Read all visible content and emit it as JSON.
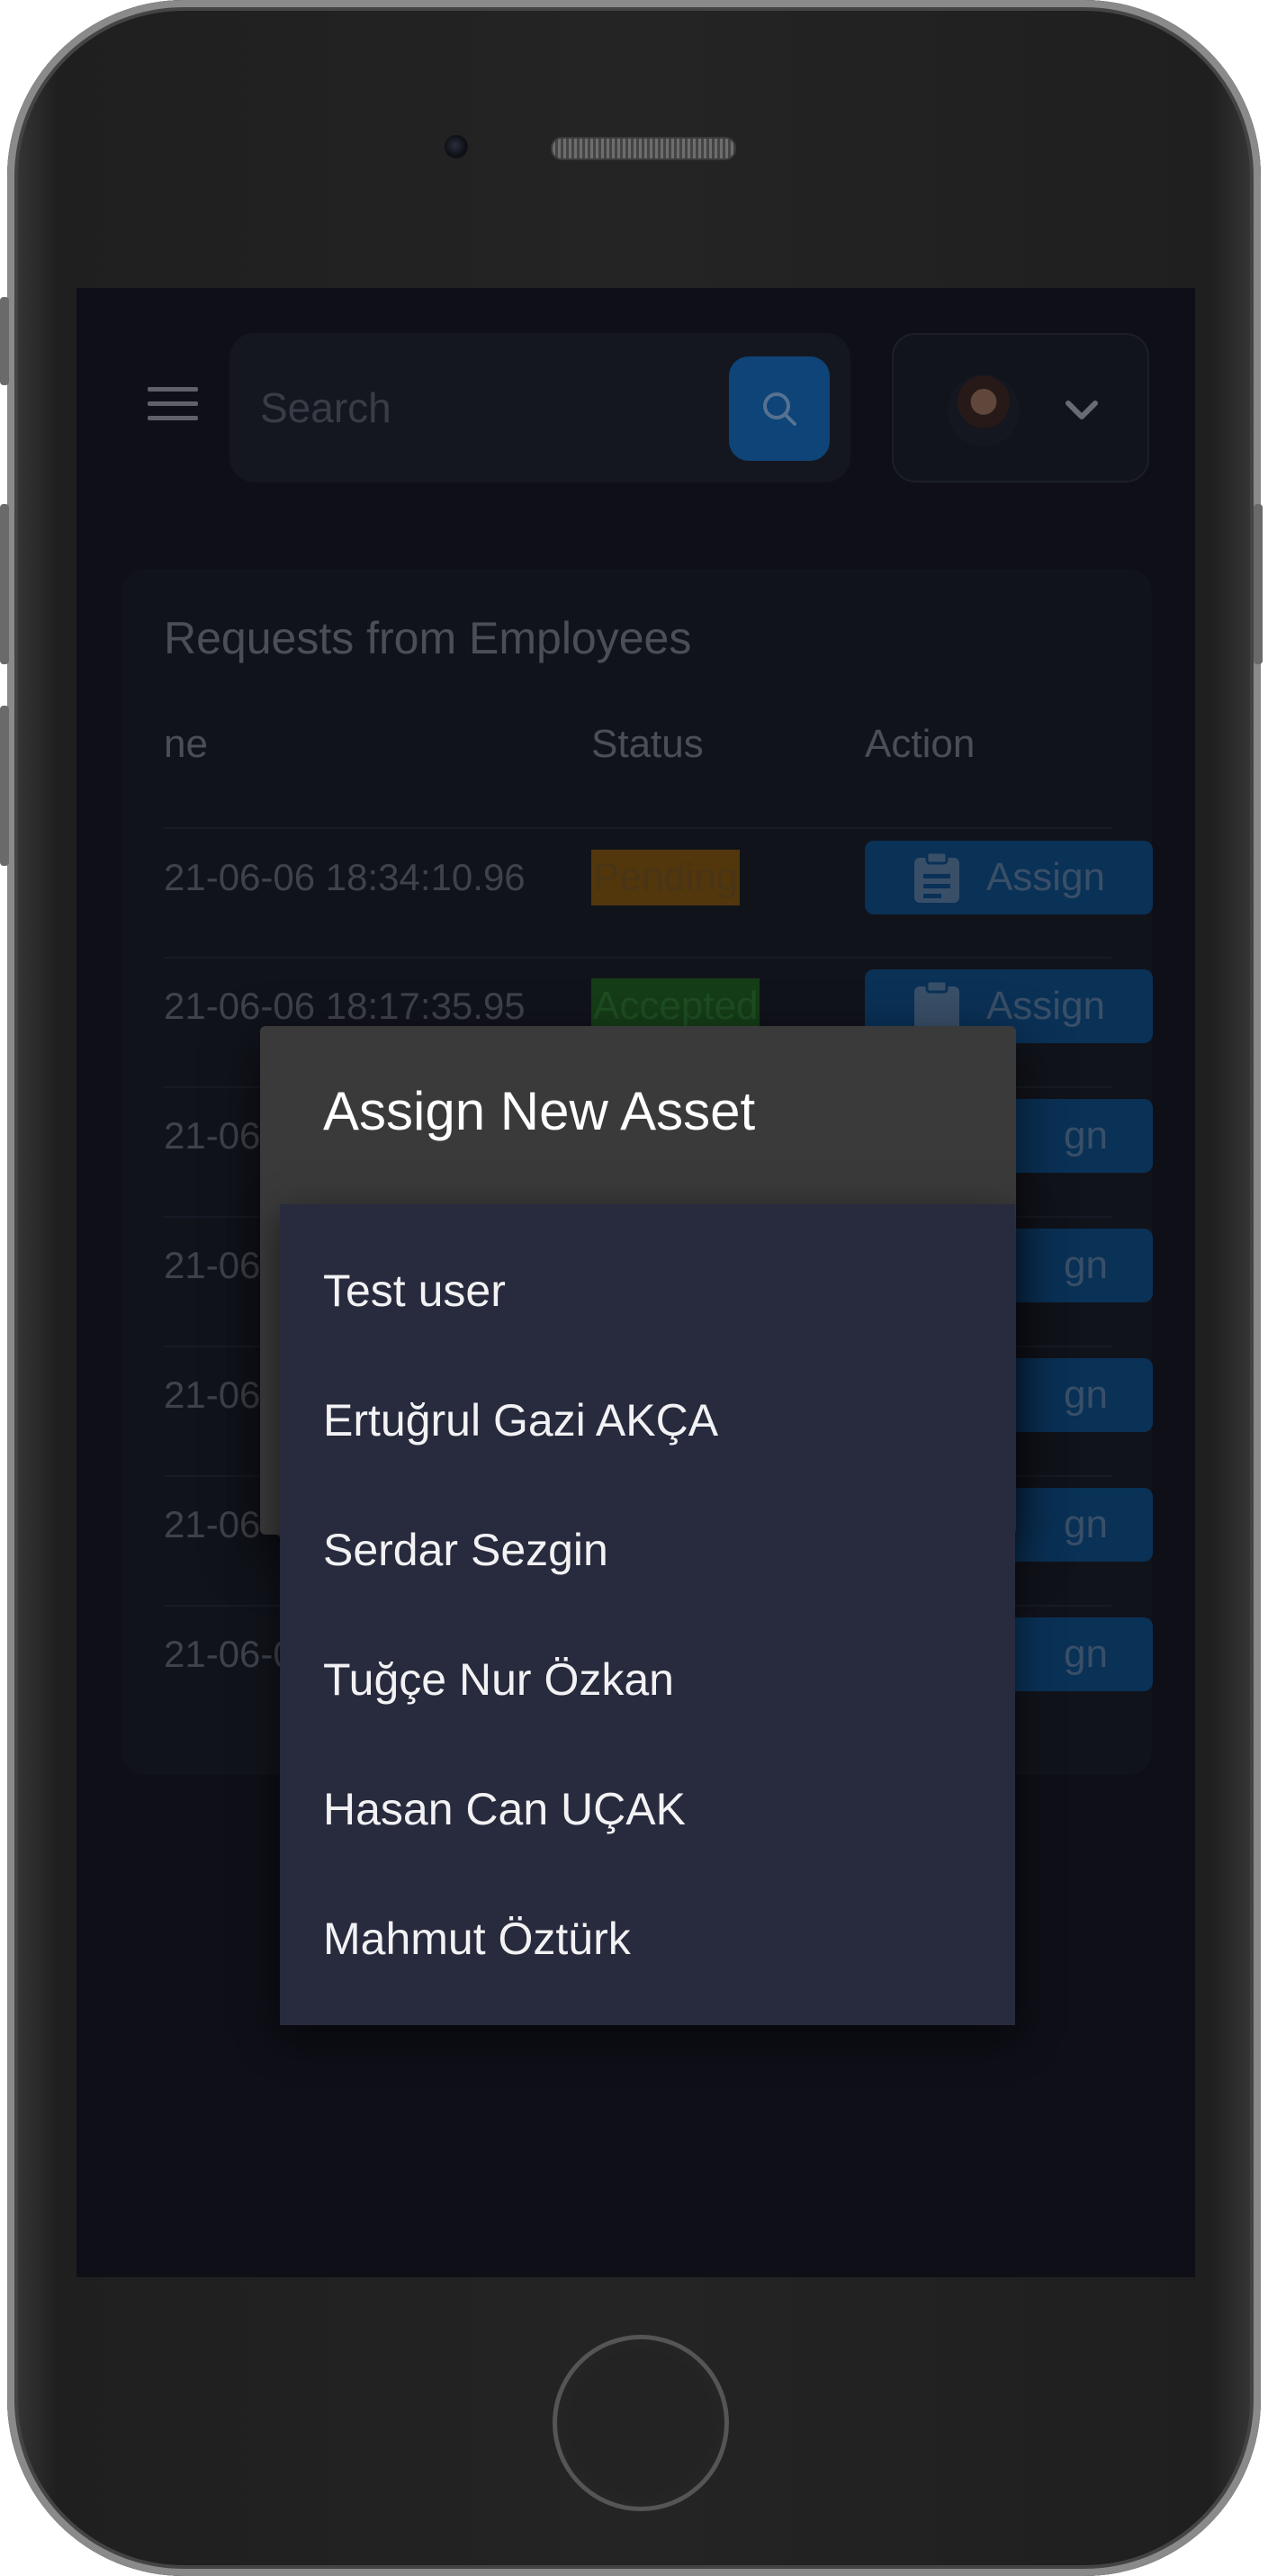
{
  "search": {
    "placeholder": "Search"
  },
  "card": {
    "title": "Requests from Employees",
    "columns": [
      "ne",
      "Status",
      "Action"
    ],
    "rows": [
      {
        "date": "21-06-06 18:34:10.960",
        "status": "Pending",
        "action": "Assign"
      },
      {
        "date": "21-06-06 18:17:35.958",
        "status": "Accepted",
        "action": "Assign"
      },
      {
        "date": "21-06-",
        "action": "gn"
      },
      {
        "date": "21-06-",
        "action": "gn"
      },
      {
        "date": "21-06-",
        "action": "gn"
      },
      {
        "date": "21-06-0",
        "action": "gn"
      },
      {
        "date": "21-06-0",
        "action": "gn"
      }
    ]
  },
  "dialog": {
    "title": "Assign New Asset",
    "options": [
      "Test user",
      "Ertuğrul Gazi AKÇA",
      "Serdar Sezgin",
      "Tuğçe Nur Özkan",
      "Hasan Can UÇAK",
      "Mahmut Öztürk"
    ]
  },
  "colors": {
    "accent": "#1565b0",
    "pending": "#7a5012",
    "accepted": "#1f5a23",
    "dropdown_bg": "#282a3d"
  },
  "icons": [
    "menu-icon",
    "search-icon",
    "chevron-down-icon",
    "clipboard-icon"
  ]
}
